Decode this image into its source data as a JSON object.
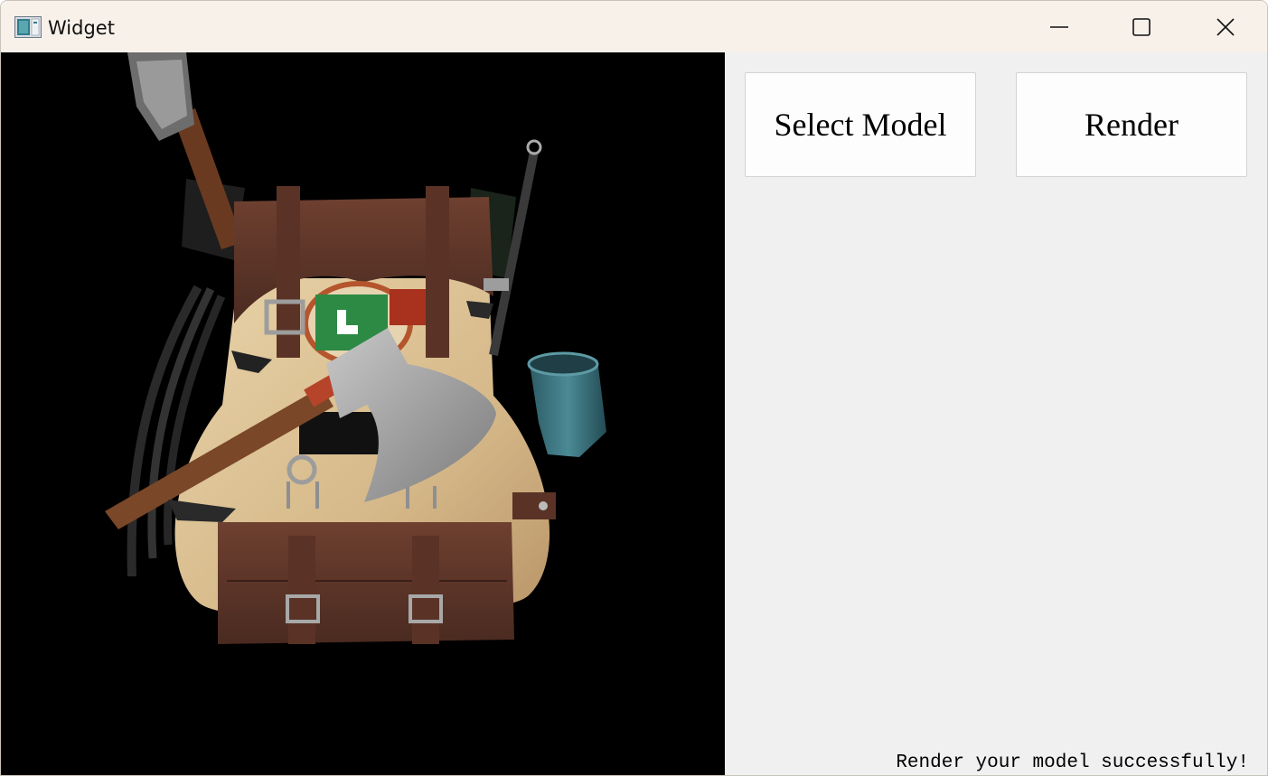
{
  "window": {
    "title": "Widget",
    "app_icon": "qt-widget-app-icon",
    "controls": [
      "minimize-icon",
      "maximize-icon",
      "close-icon"
    ]
  },
  "viewport": {
    "content": "3d-render-backpack-model",
    "background": "#000000"
  },
  "side_panel": {
    "select_model_label": "Select Model",
    "render_label": "Render",
    "status_text": "Render your model successfully!"
  },
  "colors": {
    "titlebar": "#f8f1ea",
    "panel": "#f0f0f0",
    "button": "#fdfdfd"
  }
}
